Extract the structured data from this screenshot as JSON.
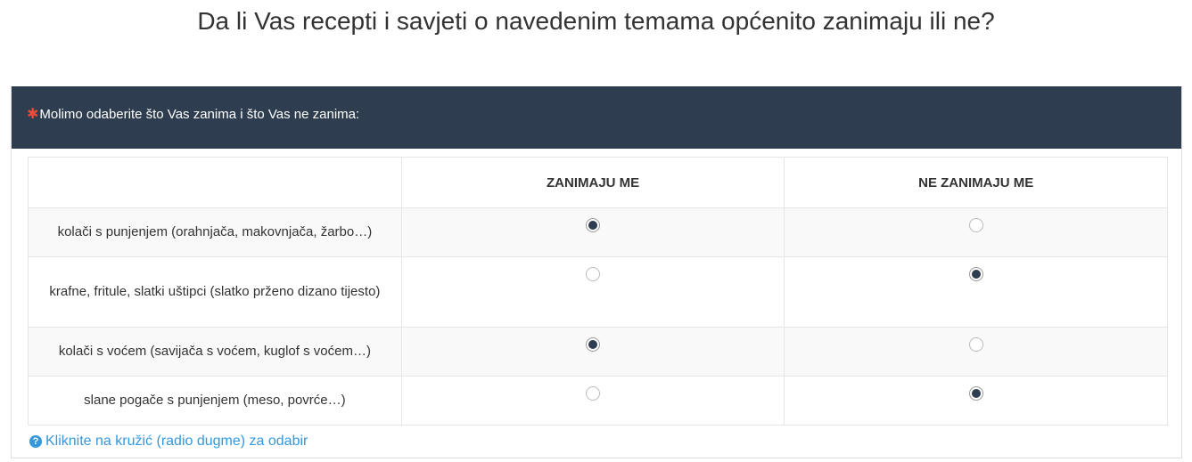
{
  "title": "Da li Vas recepti i savjeti o navedenim temama općenito zanimaju ili ne?",
  "question": {
    "required_marker": "✱",
    "text": "Molimo odaberite što Vas zanima i što Vas ne zanima:"
  },
  "columns": [
    "",
    "ZANIMAJU ME",
    "NE ZANIMAJU ME"
  ],
  "rows": [
    {
      "label": "kolači s punjenjem (orahnjača, makovnjača, žarbo…)",
      "selected": 1
    },
    {
      "label": "krafne, fritule, slatki uštipci (slatko prženo dizano tijesto)",
      "selected": 2
    },
    {
      "label": "kolači s voćem (savijača s voćem, kuglof s voćem…)",
      "selected": 1
    },
    {
      "label": "slane pogače s punjenjem (meso, povrće…)",
      "selected": 2
    }
  ],
  "help": {
    "icon": "?",
    "text": "Kliknite na kružić (radio dugme) za odabir"
  },
  "colors": {
    "header_bg": "#2e3e50",
    "accent": "#3498db",
    "required": "#e74c3c"
  }
}
